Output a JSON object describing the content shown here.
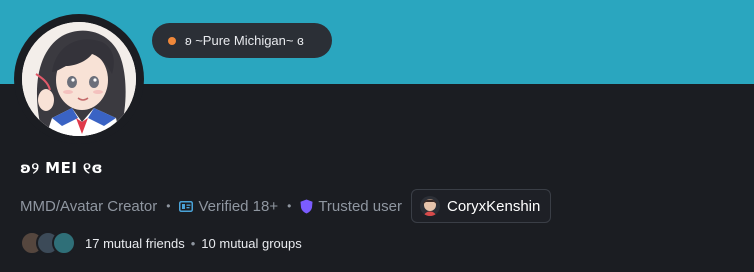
{
  "profile": {
    "status_text": "ʚ ~Pure Michigan~ ɞ",
    "status_color": "#f0883a",
    "display_name": "ʚ୨ MEI ୧ɞ",
    "role": "MMD/Avatar Creator",
    "badges": [
      {
        "label": "Verified 18+",
        "icon": "id-card-icon"
      },
      {
        "label": "Trusted user",
        "icon": "shield-icon"
      }
    ],
    "friend": {
      "name": "CoryxKenshin",
      "icon": "friend-avatar"
    }
  },
  "mutuals": {
    "friends": "17 mutual friends",
    "groups": "10 mutual groups"
  },
  "colors": {
    "banner": "#2aa6bf",
    "background": "#1b1d22",
    "trusted": "#7b5cff",
    "verified": "#4aa3d8"
  }
}
